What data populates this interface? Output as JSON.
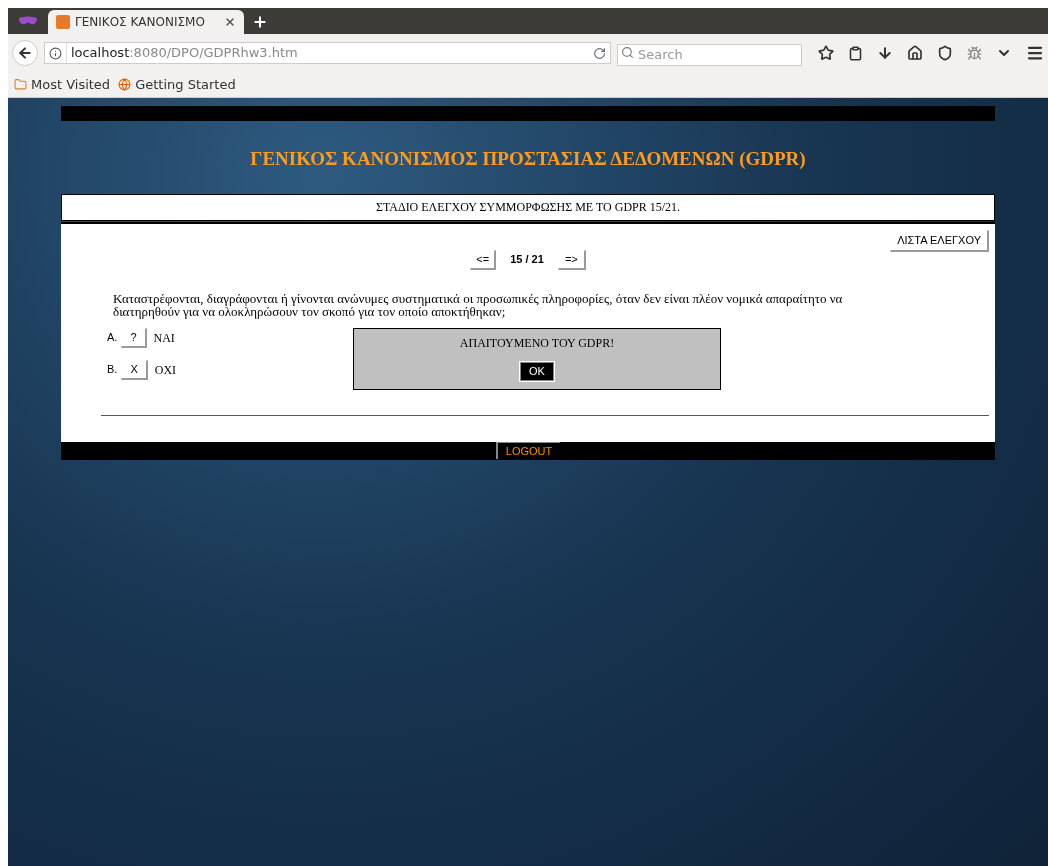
{
  "browser": {
    "tab_title": "ΓΕΝΙΚΟΣ ΚΑΝΟΝΙΣΜΟ",
    "url_host": "localhost",
    "url_path": ":8080/DPO/GDPRhw3.htm",
    "search": {
      "placeholder": "Search"
    },
    "bookmarks": [
      {
        "label": "Most Visited",
        "kind": "folder"
      },
      {
        "label": "Getting Started",
        "kind": "globe"
      }
    ]
  },
  "page": {
    "title": "ΓΕΝΙΚΟΣ ΚΑΝΟΝΙΣΜΟΣ ΠΡΟΣΤΑΣΙΑΣ ΔΕΔΟΜΕΝΩΝ (GDPR)",
    "stage_heading": "ΣΤΑΔΙΟ ΕΛΕΓΧΟΥ ΣΥΜΜΟΡΦΩΣΗΣ ΜΕ ΤΟ GDPR 15/21.",
    "checklist_button": "ΛΙΣΤΑ ΕΛΕΓΧΟΥ",
    "prev_button": "<=",
    "counter": "15 / 21",
    "next_button": "=>",
    "question": "Καταστρέφονται, διαγράφονται ή γίνονται ανώνυμες συστηματικά οι προσωπικές πληροφορίες, όταν δεν είναι πλέον νομικά απαραίτητο να διατηρηθούν για να ολοκληρώσουν τον σκοπό για τον οποίο αποκτήθηκαν;",
    "answers": [
      {
        "letter": "A.",
        "mark": "?",
        "label": "ΝΑΙ"
      },
      {
        "letter": "B.",
        "mark": "X",
        "label": "ΟΧΙ"
      }
    ],
    "dialog": {
      "message": "ΑΠΑΙΤΟΥΜΕΝΟ ΤΟΥ GDPR!",
      "ok_button": "OK"
    },
    "logout_button": "LOGOUT"
  }
}
